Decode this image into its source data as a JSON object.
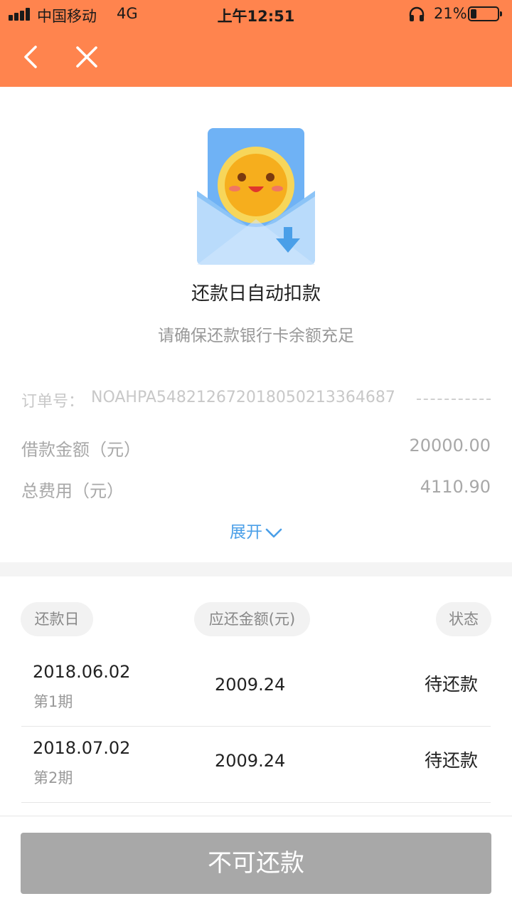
{
  "status_bar": {
    "carrier": "中国移动",
    "network": "4G",
    "time": "上午12:51",
    "battery_percent": "21%",
    "battery_level": 0.21,
    "icons": [
      "signal-icon",
      "headphone-icon",
      "battery-icon"
    ]
  },
  "nav": {
    "back_icon": "chevron-left-icon",
    "close_icon": "close-icon"
  },
  "hero": {
    "icon": "envelope-smiley-coin-illustration",
    "title": "还款日自动扣款",
    "subtitle": "请确保还款银行卡余额充足"
  },
  "order": {
    "label": "订单号：",
    "number": "NOAHPA548212672018050213364687"
  },
  "summary": {
    "loan_amount_label": "借款金额（元）",
    "loan_amount_value": "20000.00",
    "total_fee_label": "总费用（元）",
    "total_fee_value": "4110.90",
    "expand_label": "展开",
    "expand_icon": "chevron-down-icon"
  },
  "schedule": {
    "headers": {
      "date": "还款日",
      "amount": "应还金额(元)",
      "status": "状态"
    },
    "rows": [
      {
        "date": "2018.06.02",
        "period": "第1期",
        "amount": "2009.24",
        "status": "待还款"
      },
      {
        "date": "2018.07.02",
        "period": "第2期",
        "amount": "2009.24",
        "status": "待还款"
      }
    ]
  },
  "footer": {
    "button_label": "不可还款"
  },
  "colors": {
    "header": "#FF844E",
    "link": "#4A9FE8",
    "button_disabled": "#A8A8A8"
  }
}
